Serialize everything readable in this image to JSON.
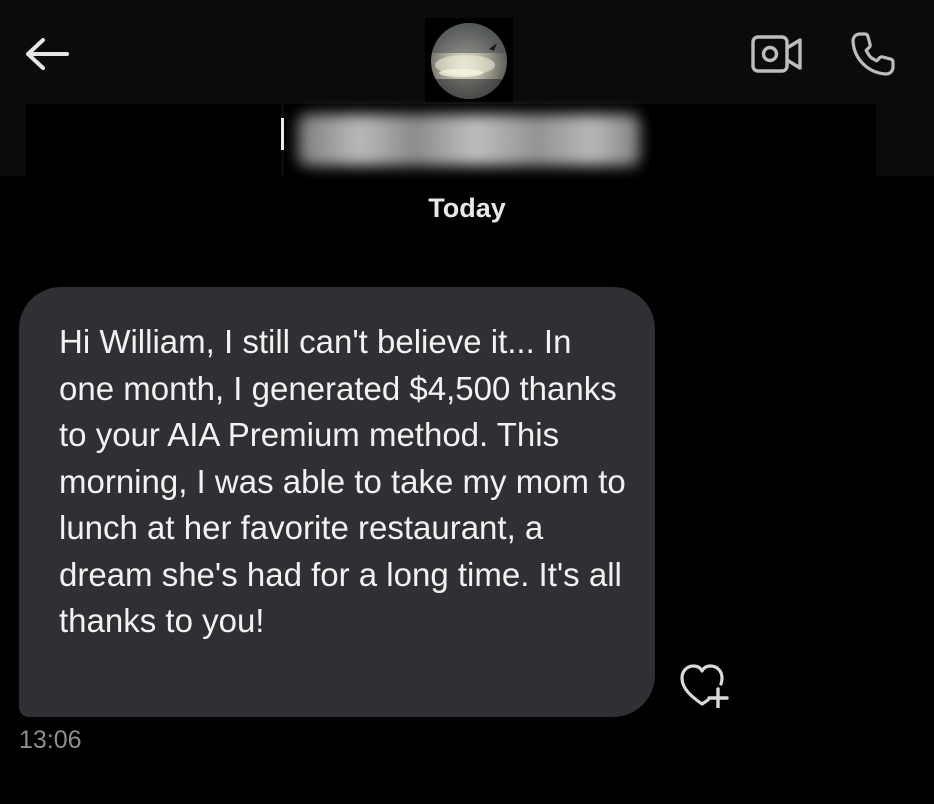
{
  "header": {
    "back_icon": "arrow-left-icon",
    "avatar_icon": "profile-photo",
    "video_icon": "video-camera-icon",
    "call_icon": "phone-icon",
    "contact_name_state": "blurred"
  },
  "conversation": {
    "date_separator": "Today",
    "messages": [
      {
        "text": "Hi William, I still can't believe it... In one month, I generated $4,500 thanks to your AIA Premium method. This morning, I was able to take my mom to lunch at her favorite restaurant, a dream she's had for a long time. It's all thanks to you!",
        "time": "13:06",
        "react_icon": "heart-plus-icon"
      }
    ]
  },
  "colors": {
    "background": "#000000",
    "header_background": "#0b0b0b",
    "bubble_background": "#2f3033",
    "text_primary": "#f2f2f2",
    "timestamp": "#8b8d91",
    "icon": "#d9d9d9"
  }
}
